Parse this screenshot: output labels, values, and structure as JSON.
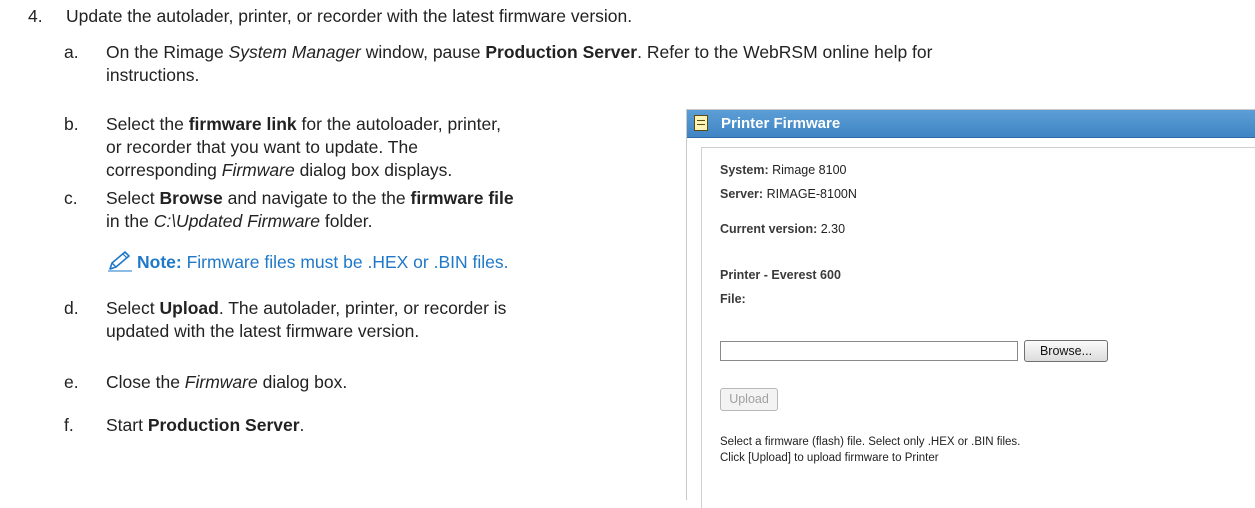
{
  "step": {
    "number": "4.",
    "text": "Update the autolader, printer, or recorder with the latest firmware version."
  },
  "substeps": [
    {
      "letter": "a.",
      "line1": [
        "On the Rimage ",
        "System Manager",
        " window, pause ",
        "Production Server",
        ". Refer to the WebRSM online help for"
      ],
      "line2": [
        "instructions."
      ]
    },
    {
      "letter": "b.",
      "line1": [
        "Select the ",
        "firmware link",
        " for the autoloader, printer,"
      ],
      "line2": [
        "or recorder that you want to update. The"
      ],
      "line3": [
        "corresponding ",
        "Firmware",
        " dialog box displays."
      ]
    },
    {
      "letter": "c.",
      "line1": [
        "Select ",
        "Browse",
        " and navigate to the the ",
        "firmware file"
      ],
      "line2": [
        "in the ",
        "C:\\Updated Firmware",
        " folder."
      ]
    },
    {
      "letter": "d.",
      "line1": [
        "Select ",
        "Upload",
        ". The autolader, printer, or recorder is"
      ],
      "line2": [
        "updated with the latest firmware version."
      ]
    },
    {
      "letter": "e.",
      "line1": [
        "Close the ",
        "Firmware",
        " dialog box."
      ]
    },
    {
      "letter": "f.",
      "line1": [
        "Start ",
        "Production Server",
        "."
      ]
    }
  ],
  "note": {
    "icon": "pencil-icon",
    "label": "Note:",
    "text": " Firmware files must be .HEX or .BIN files."
  },
  "dialog": {
    "title": "Printer Firmware",
    "icon": "document-icon",
    "system_label": "System:",
    "system_value": "Rimage 8100",
    "server_label": "Server:",
    "server_value": "RIMAGE-8100N",
    "version_label": "Current version:",
    "version_value": "2.30",
    "device_label": "Printer - Everest 600",
    "file_label": "File:",
    "file_value": "",
    "browse_label": "Browse...",
    "upload_label": "Upload",
    "help_line1": "Select a firmware (flash) file. Select only .HEX or .BIN files.",
    "help_line2": "Click [Upload] to upload firmware to Printer"
  },
  "colors": {
    "note": "#1f78c8",
    "header": "#4a8fcd"
  }
}
